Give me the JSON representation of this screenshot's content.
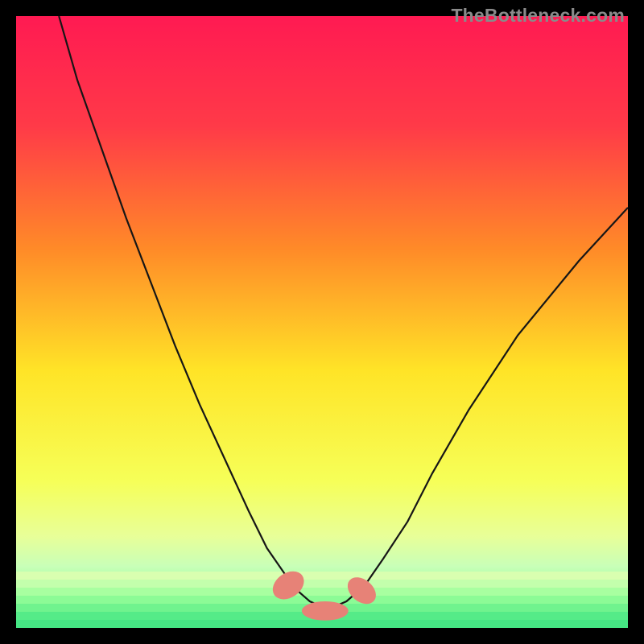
{
  "watermark": "TheBottleneck.com",
  "colors": {
    "bg": "#000000",
    "gradient_top": "#ff1a52",
    "gradient_mid1": "#ff8a28",
    "gradient_mid2": "#ffe427",
    "gradient_mid3": "#f0ff6a",
    "gradient_bottom_band1": "#d9ffb0",
    "gradient_bottom_band2": "#9bff9b",
    "gradient_bottom_band3": "#55f08e",
    "curve_stroke": "#161616",
    "marker_fill": "#e78277"
  },
  "chart_data": {
    "type": "line",
    "title": "",
    "xlabel": "",
    "ylabel": "",
    "xlim": [
      0,
      100
    ],
    "ylim": [
      -5,
      110
    ],
    "grid": false,
    "legend": false,
    "series": [
      {
        "name": "bottleneck-curve",
        "x": [
          7,
          10,
          14,
          18,
          22,
          26,
          30,
          34,
          38,
          41,
          44,
          46,
          48,
          50,
          52,
          54,
          57,
          60,
          64,
          68,
          74,
          82,
          92,
          100
        ],
        "y": [
          110,
          98,
          85,
          72,
          60,
          48,
          37,
          27,
          17,
          10,
          5,
          2,
          0,
          -1,
          -1,
          0,
          3,
          8,
          15,
          24,
          36,
          50,
          64,
          74
        ]
      }
    ],
    "markers": [
      {
        "name": "marker-left",
        "cx": 44.5,
        "cy": 3.0,
        "rx": 2.0,
        "ry": 3.2,
        "angle": 55
      },
      {
        "name": "marker-center",
        "cx": 50.5,
        "cy": -1.8,
        "rx": 3.8,
        "ry": 1.8,
        "angle": 0
      },
      {
        "name": "marker-right",
        "cx": 56.5,
        "cy": 2.0,
        "rx": 1.8,
        "ry": 3.0,
        "angle": -50
      }
    ],
    "gradient_stops": [
      {
        "offset": 0.0,
        "color": "#ff1a52"
      },
      {
        "offset": 0.18,
        "color": "#ff3a48"
      },
      {
        "offset": 0.38,
        "color": "#ff8a28"
      },
      {
        "offset": 0.58,
        "color": "#ffe427"
      },
      {
        "offset": 0.76,
        "color": "#f6ff58"
      },
      {
        "offset": 0.85,
        "color": "#e8ff98"
      },
      {
        "offset": 0.9,
        "color": "#c8ffb8"
      },
      {
        "offset": 0.94,
        "color": "#8fff9a"
      },
      {
        "offset": 0.97,
        "color": "#55f08e"
      },
      {
        "offset": 1.0,
        "color": "#3fe686"
      }
    ]
  }
}
